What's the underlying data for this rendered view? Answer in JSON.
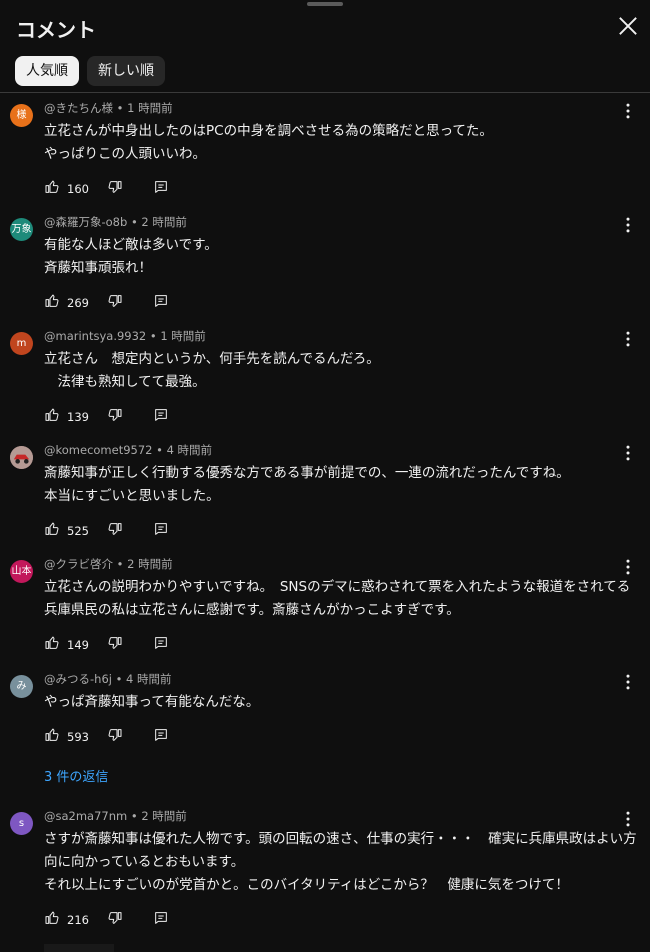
{
  "header": {
    "title": "コメント"
  },
  "sort_chips": [
    {
      "label": "人気順",
      "selected": true
    },
    {
      "label": "新しい順",
      "selected": false
    }
  ],
  "comments": [
    {
      "avatar_text": "様",
      "avatar_color": "#e8711a",
      "meta": "@きたちん様 • 1 時間前",
      "lines": [
        "立花さんが中身出したのはPCの中身を調べさせる為の策略だと思ってた。",
        "やっぱりこの人頭いいわ。"
      ],
      "likes": "160"
    },
    {
      "avatar_text": "万象",
      "avatar_color": "#1e8a7a",
      "meta": "@森羅万象-o8b • 2 時間前",
      "lines": [
        "有能な人ほど敵は多いです。",
        "斉藤知事頑張れ！"
      ],
      "likes": "269"
    },
    {
      "avatar_text": "m",
      "avatar_color": "#c0451e",
      "meta": "@marintsya.9932 • 1 時間前",
      "lines": [
        "立花さん　想定内というか、何手先を読んでるんだろ。",
        "　法律も熟知してて最強。"
      ],
      "likes": "139"
    },
    {
      "avatar_text": "",
      "avatar_color": "#8a6f6a",
      "meta": "@komecomet9572 • 4 時間前",
      "lines": [
        "斎藤知事が正しく行動する優秀な方である事が前提での、一連の流れだったんですね。",
        "本当にすごいと思いました。"
      ],
      "likes": "525"
    },
    {
      "avatar_text": "山本",
      "avatar_color": "#c2185b",
      "meta": "@クラビ啓介 • 2 時間前",
      "lines": [
        "立花さんの説明わかりやすいですね。　SNSのデマに惑わされて票を入れたような報道をされてる",
        "兵庫県民の私は立花さんに感謝です。斎藤さんがかっこよすぎです。"
      ],
      "likes": "149"
    },
    {
      "avatar_text": "み",
      "avatar_color": "#78909c",
      "meta": "@みつる-h6j • 4 時間前",
      "lines": [
        "やっぱ斉藤知事って有能なんだな。"
      ],
      "likes": "593"
    },
    {
      "avatar_text": "s",
      "avatar_color": "#7e57c2",
      "meta": "@sa2ma77nm • 2 時間前",
      "lines": [
        "さすが斎藤知事は優れた人物です。頭の回転の速さ、仕事の実行・・・　確実に兵庫県政はよい方",
        "向に向かっているとおもいます。",
        "それ以上にすごいのが党首かと。このバイタリティはどこから？　健康に気をつけて！"
      ],
      "likes": "216"
    }
  ],
  "replies_link": "3 件の返信"
}
